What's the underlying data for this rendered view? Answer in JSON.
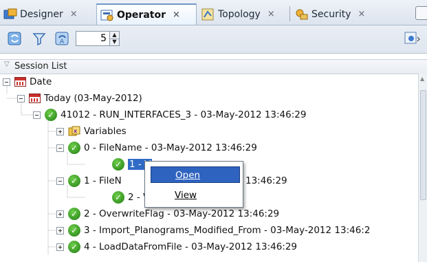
{
  "tabs": [
    {
      "label": "Designer",
      "icon": "designer-icon",
      "active": false
    },
    {
      "label": "Operator",
      "icon": "operator-icon",
      "active": true
    },
    {
      "label": "Topology",
      "icon": "topology-icon",
      "active": false
    },
    {
      "label": "Security",
      "icon": "security-icon",
      "active": false
    }
  ],
  "tab_close": "×",
  "toolbar": {
    "spinner_value": "5",
    "spin_up": "▲",
    "spin_down": "▼"
  },
  "session_list": {
    "title": "Session List",
    "caret": "▽"
  },
  "tree": {
    "date": "Date",
    "today": "Today (03-May-2012)",
    "session": "41012 - RUN_INTERFACES_3 - 03-May-2012 13:46:29",
    "variables": "Variables",
    "step0": "0 - FileName - 03-May-2012 13:46:29",
    "step0_child": "1 - V",
    "step1": "1 - FileN",
    "step1_time": "13:46:29",
    "step1_child": "2 - V",
    "step2": "2 - OverwriteFlag - 03-May-2012 13:46:29",
    "step3": "3 - Import_Planograms_Modified_From - 03-May-2012 13:46:2",
    "step4": "4 - LoadDataFromFile - 03-May-2012 13:46:29"
  },
  "context_menu": {
    "open": "Open",
    "view": "View"
  },
  "colors": {
    "accent": "#2f63c0",
    "success": "#2f9a1e",
    "date_icon": "#c9302c"
  }
}
